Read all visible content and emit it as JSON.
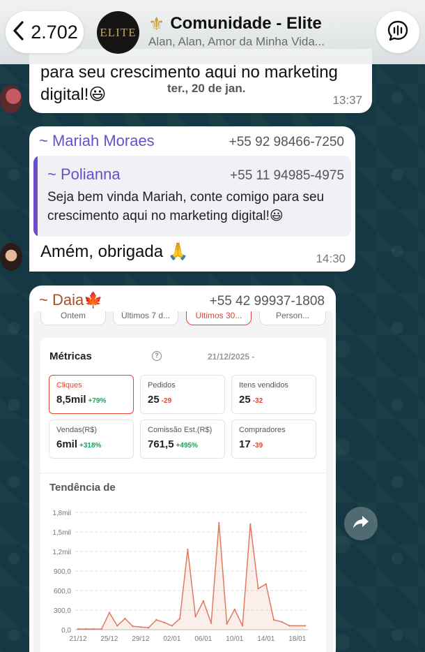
{
  "header": {
    "back_count": "2.702",
    "avatar_text": "ELITE",
    "title_icon": "⚜",
    "title": "Comunidade - Elite",
    "subtitle": "Alan, Alan, Amor da Minha Vida..."
  },
  "date_separator": "ter., 20 de jan.",
  "messages": [
    {
      "text_line1": "para seu crescimento aqui no marketing",
      "text_line2": "digital!😃",
      "time": "13:37"
    },
    {
      "sender": "~ Mariah Moraes",
      "sender_color": "#6a4fc7",
      "phone": "+55 92 98466-7250",
      "quote": {
        "sender": "~ Polianna",
        "phone": "+55 11 94985-4975",
        "line1": "Seja bem vinda Mariah, conte comigo para seu",
        "line2": "crescimento aqui no marketing digital!😃"
      },
      "text": "Amém, obrigada 🙏",
      "time": "14:30"
    },
    {
      "sender": "~ Daia🍁",
      "sender_color": "#a0522d",
      "phone": "+55 42 99937-1808"
    }
  ],
  "screenshot": {
    "chips": [
      "Ontem",
      "Últimos 7 d...",
      "Últimos 30...",
      "Person..."
    ],
    "metrics_title": "Métricas",
    "help_icon": "?",
    "date_range": "21/12/2025 -",
    "metrics": [
      {
        "label": "Cliques",
        "value": "8,5mil",
        "change": "+79%",
        "trend": "up",
        "selected": true
      },
      {
        "label": "Pedidos",
        "value": "25",
        "change": "-29",
        "trend": "down"
      },
      {
        "label": "Itens vendidos",
        "value": "25",
        "change": "-32",
        "trend": "down"
      },
      {
        "label": "Vendas(R$)",
        "value": "6mil",
        "change": "+318%",
        "trend": "up"
      },
      {
        "label": "Comissão Est.(R$)",
        "value": "761,5",
        "change": "+495%",
        "trend": "up"
      },
      {
        "label": "Compradores",
        "value": "17",
        "change": "-39",
        "trend": "down"
      }
    ],
    "trend_title": "Tendência de"
  },
  "chart_data": {
    "type": "area",
    "title": "Tendência de",
    "y_ticks": [
      "0,0",
      "300,0",
      "600,0",
      "900,0",
      "1,2mil",
      "1,5mil",
      "1,8mil"
    ],
    "ylim": [
      0,
      1800
    ],
    "x_ticks": [
      "21/12",
      "25/12",
      "29/12",
      "02/01",
      "06/01",
      "10/01",
      "14/01",
      "18/01"
    ],
    "series": [
      {
        "color": "#e07a5f",
        "x": [
          "21/12",
          "22/12",
          "23/12",
          "24/12",
          "25/12",
          "26/12",
          "27/12",
          "28/12",
          "29/12",
          "30/12",
          "31/12",
          "01/01",
          "02/01",
          "03/01",
          "04/01",
          "05/01",
          "06/01",
          "07/01",
          "08/01",
          "09/01",
          "10/01",
          "11/01",
          "12/01",
          "13/01",
          "14/01",
          "15/01",
          "16/01",
          "17/01",
          "18/01",
          "19/01"
        ],
        "values": [
          10,
          10,
          10,
          10,
          260,
          60,
          170,
          50,
          40,
          30,
          150,
          110,
          60,
          170,
          1230,
          200,
          440,
          100,
          1640,
          90,
          310,
          60,
          1620,
          630,
          700,
          150,
          120,
          60,
          60,
          60
        ]
      }
    ],
    "grid": true
  },
  "forward_icon": "forward-arrow"
}
